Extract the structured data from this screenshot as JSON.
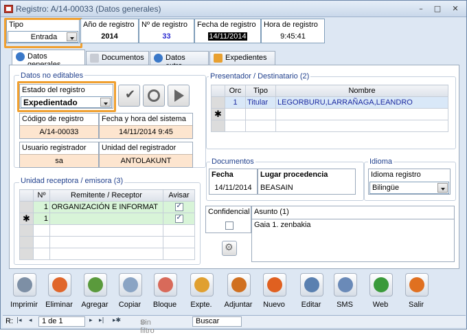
{
  "window": {
    "title": "Registro: A/14-00033 (Datos generales)"
  },
  "header": {
    "tipo_label": "Tipo",
    "tipo_value": "Entrada",
    "anio_label": "Año de registro",
    "anio_value": "2014",
    "num_label": "Nº de registro",
    "num_value": "33",
    "fecha_label": "Fecha de registro",
    "fecha_value": "14/11/2014",
    "hora_label": "Hora de registro",
    "hora_value": "9:45:41"
  },
  "tabs": [
    {
      "label": "Datos generales"
    },
    {
      "label": "Documentos"
    },
    {
      "label": "Datos extra"
    },
    {
      "label": "Expedientes"
    }
  ],
  "no_editables": {
    "group_label": "Datos no editables",
    "estado_label": "Estado del registro",
    "estado_value": "Expedientado",
    "codigo_label": "Código de registro",
    "codigo_value": "A/14-00033",
    "fechahora_label": "Fecha y hora del sistema",
    "fechahora_value": "14/11/2014 9:45",
    "usuario_label": "Usuario registrador",
    "usuario_value": "sa",
    "unidad_label": "Unidad del registrador",
    "unidad_value": "ANTOLAKUNT"
  },
  "presentador": {
    "group_label": "Presentador / Destinatario (2)",
    "columns": [
      "Orc",
      "Tipo",
      "Nombre"
    ],
    "rows": [
      {
        "orden": "1",
        "tipo": "Titular",
        "nombre": "LEGORBURU,LARRAÑAGA,LEANDRO"
      }
    ]
  },
  "documentos": {
    "group_label": "Documentos",
    "fecha_label": "Fecha",
    "fecha_value": "14/11/2014",
    "lugar_label": "Lugar procedencia",
    "lugar_value": "BEASAIN"
  },
  "idioma": {
    "group_label": "Idioma",
    "label": "Idioma registro",
    "value": "Bilingüe"
  },
  "unidad": {
    "group_label": "Unidad receptora / emisora (3)",
    "columns": [
      "Nº",
      "Remitente / Receptor",
      "Avisar"
    ],
    "rows": [
      {
        "num": "1",
        "nombre": "ORGANIZACIÓN E INFORMAT",
        "avisar": true
      },
      {
        "num": "1",
        "nombre": "",
        "avisar": true
      }
    ]
  },
  "confidencial": {
    "label": "Confidencial"
  },
  "asunto": {
    "label": "Asunto (1)",
    "value": "Gaia 1. zenbakia"
  },
  "toolbar": [
    {
      "label": "Imprimir",
      "icon": "printer-icon",
      "color": "#7d8fa5"
    },
    {
      "label": "Eliminar",
      "icon": "delete-icon",
      "color": "#e0662a"
    },
    {
      "label": "Agregar",
      "icon": "add-users-icon",
      "color": "#5a9a3c"
    },
    {
      "label": "Copiar",
      "icon": "copy-icon",
      "color": "#8aa4c4"
    },
    {
      "label": "Bloque",
      "icon": "block-icon",
      "color": "#d86a5a"
    },
    {
      "label": "Expte.",
      "icon": "folder-icon",
      "color": "#e0a030"
    },
    {
      "label": "Adjuntar",
      "icon": "paperclip-icon",
      "color": "#d07020"
    },
    {
      "label": "Nuevo",
      "icon": "new-icon",
      "color": "#e06020"
    },
    {
      "label": "Editar",
      "icon": "magnifier-icon",
      "color": "#5a80b0"
    },
    {
      "label": "SMS",
      "icon": "envelope-icon",
      "color": "#6a8ab8"
    },
    {
      "label": "Web",
      "icon": "globe-icon",
      "color": "#3a9a3a"
    },
    {
      "label": "Salir",
      "icon": "exit-icon",
      "color": "#e07020"
    }
  ],
  "statusbar": {
    "record_prefix": "R:",
    "record_value": "1 de 1",
    "filter_label": "Sin filtro",
    "search_label": "Buscar"
  }
}
